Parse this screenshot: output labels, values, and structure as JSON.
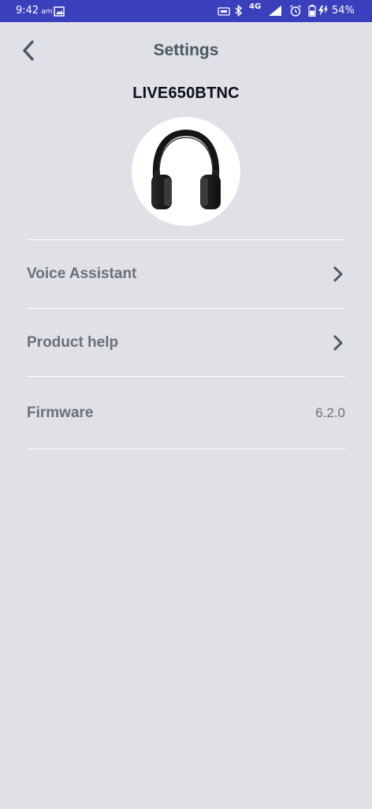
{
  "status_bar": {
    "time": "9:42",
    "ampm": "am",
    "network": "4G",
    "battery_percent": "54%"
  },
  "header": {
    "title": "Settings"
  },
  "device": {
    "name": "LIVE650BTNC"
  },
  "settings": {
    "voice_assistant_label": "Voice Assistant",
    "product_help_label": "Product help",
    "firmware_label": "Firmware",
    "firmware_value": "6.2.0"
  },
  "colors": {
    "status_bar": "#3a3fbc",
    "background": "#dfe1e6",
    "title_text": "#4b5766",
    "row_text": "#6b7078"
  }
}
